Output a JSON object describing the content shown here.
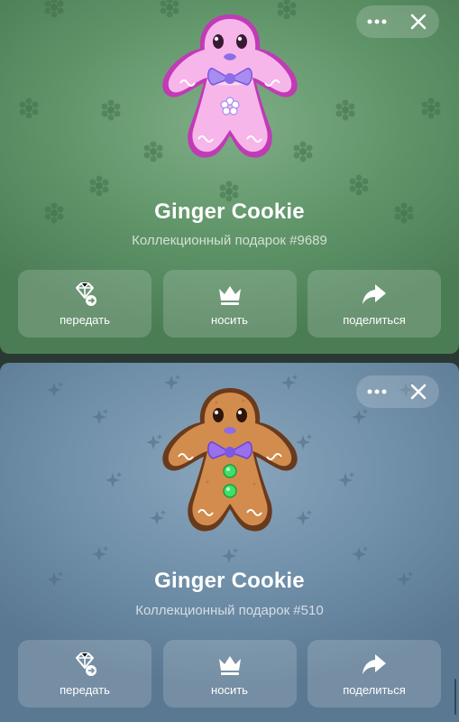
{
  "gifts": [
    {
      "title": "Ginger Cookie",
      "subtitle": "Коллекционный подарок #9689",
      "theme": {
        "background": "#5f9468",
        "cookie_body": "#f7b6ea",
        "cookie_outline": "#c13ab6",
        "bow": "#a98cf0"
      },
      "pattern_icon": "snowflake-icon",
      "controls": {
        "more_icon": "more-dots-icon",
        "close_icon": "close-icon"
      },
      "actions": [
        {
          "label": "передать",
          "icon": "gift-transfer-icon"
        },
        {
          "label": "носить",
          "icon": "crown-icon"
        },
        {
          "label": "поделиться",
          "icon": "share-arrow-icon"
        }
      ]
    },
    {
      "title": "Ginger Cookie",
      "subtitle": "Коллекционный подарок #510",
      "theme": {
        "background": "#6f8ea8",
        "cookie_body": "#d28c4e",
        "cookie_outline": "#6a3a1c",
        "bow": "#9a70ee",
        "buttons": "#3fe067"
      },
      "pattern_icon": "sparkle-icon",
      "controls": {
        "more_icon": "more-dots-icon",
        "close_icon": "close-icon"
      },
      "actions": [
        {
          "label": "передать",
          "icon": "gift-transfer-icon"
        },
        {
          "label": "носить",
          "icon": "crown-icon"
        },
        {
          "label": "поделиться",
          "icon": "share-arrow-icon"
        }
      ]
    }
  ]
}
